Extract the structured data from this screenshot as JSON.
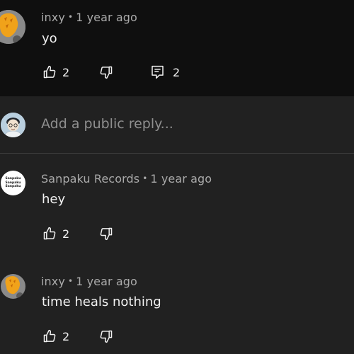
{
  "comments": [
    {
      "author": "inxy",
      "time": "1 year ago",
      "text": "yo",
      "likes": "2",
      "replies": "2"
    },
    {
      "author": "Sanpaku Records",
      "time": "1 year ago",
      "text": "hey",
      "likes": "2",
      "avatar_logo_lines": [
        "Sanpaku",
        "Sanpaku",
        "Sanpaku"
      ]
    },
    {
      "author": "inxy",
      "time": "1 year ago",
      "text": "time heals nothing",
      "likes": "2"
    }
  ],
  "reply_box": {
    "placeholder": "Add a public reply..."
  },
  "separator": "•",
  "colors": {
    "top_background": "#0f0f0f",
    "page_background": "#212121",
    "text_primary": "#f1f1f1",
    "text_secondary": "#aaaaaa",
    "placeholder": "#8f8f8f"
  },
  "icons": {
    "like": "thumbs-up-icon",
    "dislike": "thumbs-down-icon",
    "replies": "comment-icon"
  }
}
